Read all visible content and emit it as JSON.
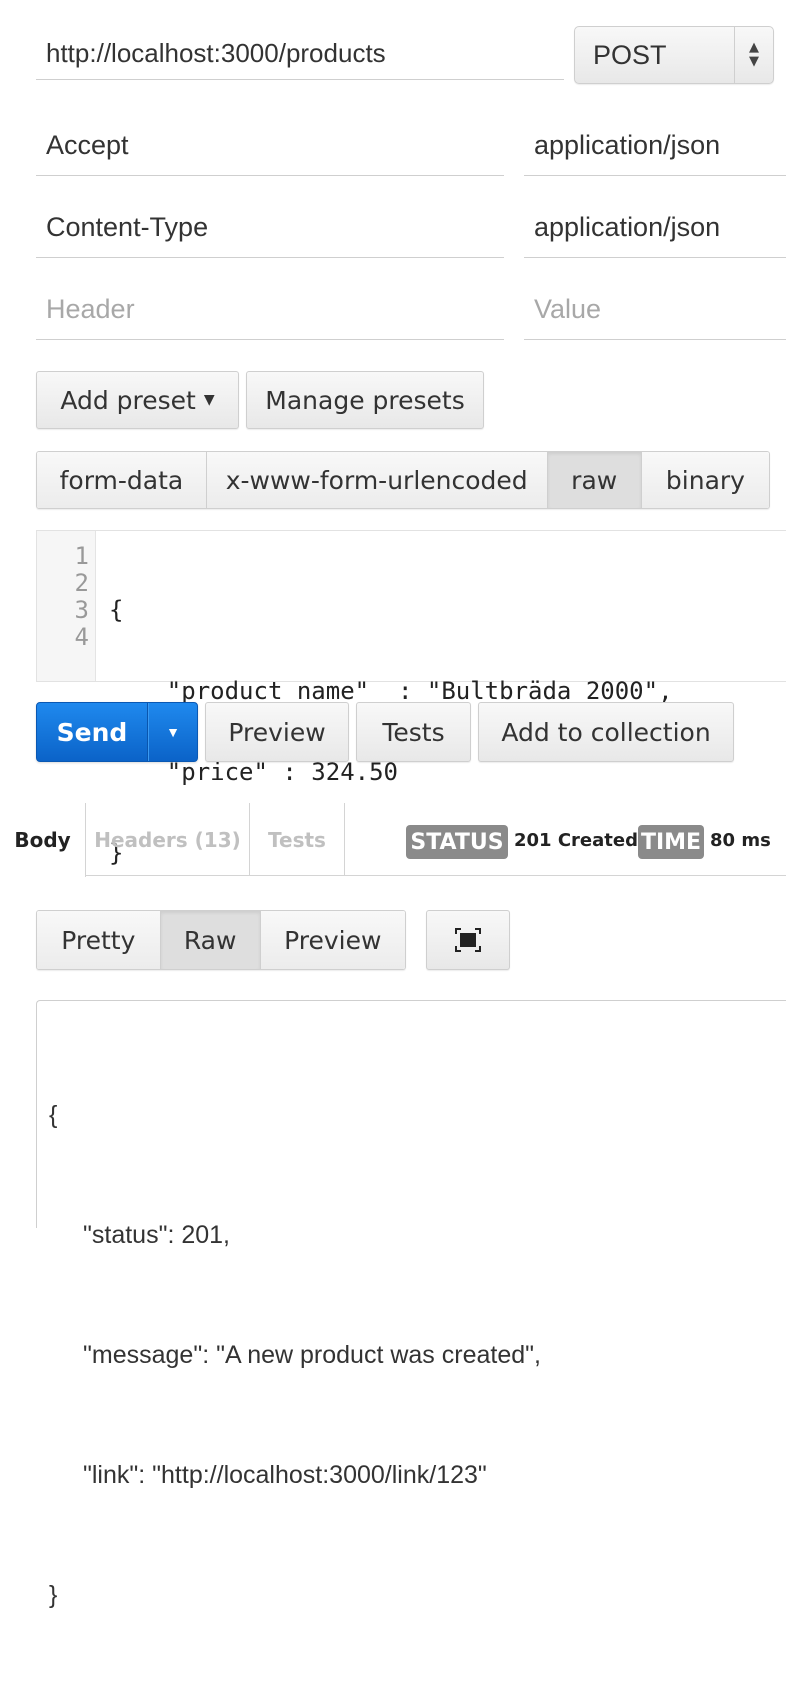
{
  "request": {
    "url": "http://localhost:3000/products",
    "method": "POST",
    "headers": [
      {
        "key": "Accept",
        "value": "application/json"
      },
      {
        "key": "Content-Type",
        "value": "application/json"
      }
    ],
    "header_placeholder": "Header",
    "value_placeholder": "Value"
  },
  "presets": {
    "add_label": "Add preset",
    "manage_label": "Manage presets"
  },
  "body_types": [
    "form-data",
    "x-www-form-urlencoded",
    "raw",
    "binary"
  ],
  "body_type_selected": "raw",
  "editor": {
    "line_numbers": [
      "1",
      "2",
      "3",
      "4"
    ],
    "lines": [
      "{",
      "    \"product_name\"  : \"Bultbräda 2000\",",
      "    \"price\" : 324.50",
      "}"
    ]
  },
  "actions": {
    "send": "Send",
    "preview": "Preview",
    "tests": "Tests",
    "add_to_collection": "Add to collection"
  },
  "response_tabs": [
    "Body",
    "Headers (13)",
    "Tests"
  ],
  "response_status": {
    "status_label": "STATUS",
    "status_value": "201 Created",
    "time_label": "TIME",
    "time_value": "80 ms"
  },
  "view_modes": [
    "Pretty",
    "Raw",
    "Preview"
  ],
  "view_mode_selected": "Raw",
  "response_body": {
    "lines": [
      "{",
      "\"status\": 201,",
      "\"message\": \"A new product was created\",",
      "\"link\": \"http://localhost:3000/link/123\"",
      "}"
    ]
  },
  "colors": {
    "send_button": "#1577d9",
    "badge": "#8a8a8a",
    "border": "#cfcfcf"
  }
}
